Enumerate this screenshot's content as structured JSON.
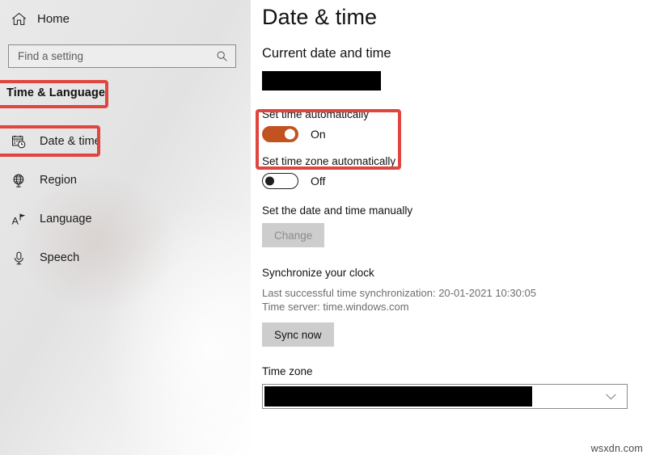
{
  "sidebar": {
    "home": {
      "label": "Home",
      "icon": "home-icon"
    },
    "search": {
      "value": "",
      "placeholder": "Find a setting",
      "icon": "search-icon"
    },
    "group_header": "Time & Language",
    "items": [
      {
        "label": "Date & time",
        "icon": "calendar-clock-icon",
        "selected": true
      },
      {
        "label": "Region",
        "icon": "globe-icon",
        "selected": false
      },
      {
        "label": "Language",
        "icon": "language-icon",
        "selected": false
      },
      {
        "label": "Speech",
        "icon": "microphone-icon",
        "selected": false
      }
    ]
  },
  "main": {
    "title": "Date & time",
    "current_section_title": "Current date and time",
    "current_clock_value": "",
    "set_time_automatically": {
      "label": "Set time automatically",
      "state": "On",
      "on": true
    },
    "set_timezone_automatically": {
      "label": "Set time zone automatically",
      "state": "Off",
      "on": false
    },
    "manual": {
      "label": "Set the date and time manually",
      "button_label": "Change",
      "button_disabled": true
    },
    "sync": {
      "section_title": "Synchronize your clock",
      "last_sync": "Last successful time synchronization: 20-01-2021 10:30:05",
      "time_server": "Time server: time.windows.com",
      "button_label": "Sync now"
    },
    "timezone": {
      "label": "Time zone",
      "value": "",
      "arrow_icon": "chevron-down-icon"
    }
  },
  "annotations": {
    "highlight_color": "#e0453f",
    "boxes": [
      "time-and-language",
      "date-and-time",
      "set-time-automatically"
    ]
  },
  "watermark": {
    "text": "wsxdn.com"
  }
}
